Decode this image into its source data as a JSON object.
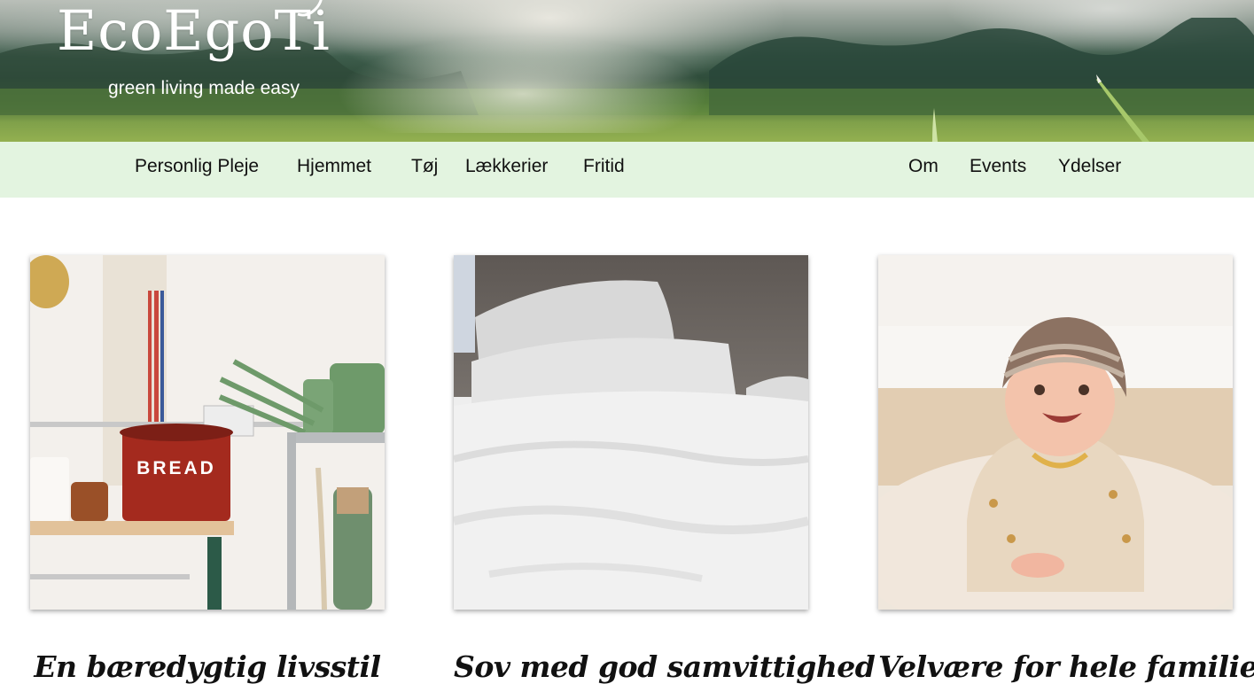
{
  "brand": {
    "logo_text": "EcoEgoTi",
    "tagline": "green living made easy"
  },
  "nav": {
    "left": [
      "Personlig Pleje",
      "Hjemmet",
      "Tøj",
      "Lækkerier",
      "Fritid"
    ],
    "right": [
      "Om",
      "Events",
      "Ydelser"
    ]
  },
  "cards": [
    {
      "title": "En bæredygtig livsstil",
      "image": "kitchen-shelf-bread-tin-photo",
      "image_text": "BREAD"
    },
    {
      "title": "Sov med god samvittighed",
      "image": "white-bed-linen-photo"
    },
    {
      "title": "Velvære for hele familien",
      "image": "smiling-baby-on-rug-photo"
    }
  ],
  "colors": {
    "nav_bg": "#e3f4e0",
    "text": "#111111",
    "logo": "#ffffff"
  }
}
